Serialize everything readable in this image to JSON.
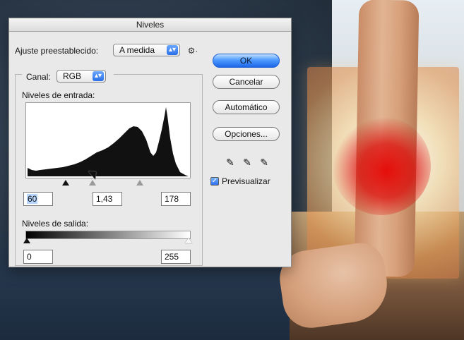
{
  "dialog": {
    "title": "Niveles",
    "preset_label": "Ajuste preestablecido:",
    "preset_value": "A medida",
    "channel_label": "Canal:",
    "channel_value": "RGB",
    "input_levels_label": "Niveles de entrada:",
    "input_values": {
      "black": "60",
      "gamma": "1,43",
      "white": "178"
    },
    "output_levels_label": "Niveles de salida:",
    "output_values": {
      "black": "0",
      "white": "255"
    },
    "buttons": {
      "ok": "OK",
      "cancel": "Cancelar",
      "auto": "Automático",
      "options": "Opciones..."
    },
    "preview": {
      "label": "Previsualizar",
      "checked": true
    },
    "icons": {
      "preset_menu": "gear-icon",
      "stepper": "up-down-arrows-icon",
      "eyedroppers": [
        "black-eyedropper-icon",
        "gray-eyedropper-icon",
        "white-eyedropper-icon"
      ]
    },
    "colors": {
      "accent": "#2a6fe8",
      "dialog_bg": "#e9e9e9"
    }
  }
}
